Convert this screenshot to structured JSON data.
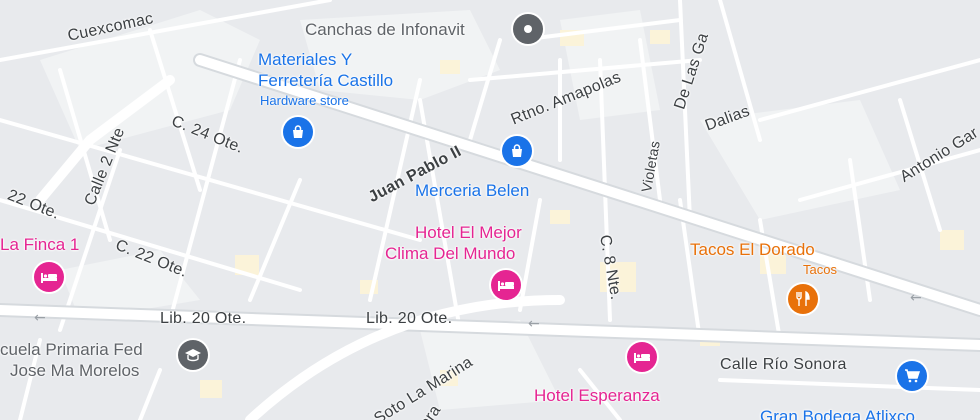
{
  "colors": {
    "shopping": "#1a73e8",
    "lodging": "#e52592",
    "food": "#e8710a",
    "landmark": "#5f6368",
    "street_text": "#3c4043"
  },
  "streets": {
    "cuexcomac": "Cuexcomac",
    "c24": "C. 24 Ote.",
    "calle2": "Calle 2 Nte",
    "c22a": "22 Ote.",
    "c22b": "C. 22 Ote.",
    "juan_pablo": "Juan Pablo II",
    "amapolas": "Rtno. Amapolas",
    "de_las": "De Las Ga",
    "dalias": "Dalias",
    "violetas": "Violetas",
    "antonio": "Antonio Gar",
    "c8": "C. 8 Nte.",
    "lib20a": "Lib. 20 Ote.",
    "lib20b": "Lib. 20 Ote.",
    "rio_sonora": "Calle Río Sonora",
    "soto": "Soto La Marina",
    "ora": "ora"
  },
  "pois": {
    "canchas": {
      "name": "Canchas de Infonavit",
      "icon": "landmark-pin-icon"
    },
    "materiales": {
      "name1": "Materiales Y",
      "name2": "Ferretería Castillo",
      "category": "Hardware store",
      "icon": "shopping-bag-icon"
    },
    "merceria": {
      "name": "Merceria Belen",
      "icon": "shopping-bag-icon"
    },
    "hotel_mejor": {
      "name1": "Hotel El Mejor",
      "name2": "Clima Del Mundo",
      "icon": "bed-icon"
    },
    "la_finca": {
      "name": "La Finca 1",
      "icon": "bed-icon"
    },
    "tacos": {
      "name": "Tacos El Dorado",
      "category": "Tacos",
      "icon": "fork-knife-icon"
    },
    "escuela": {
      "name1": "cuela Primaria Fed",
      "name2": "Jose Ma Morelos",
      "icon": "school-icon"
    },
    "hotel_esperanza": {
      "name": "Hotel Esperanza",
      "icon": "bed-icon"
    },
    "bodega": {
      "name": "Gran Bodega Atlixco",
      "icon": "shopping-cart-icon"
    }
  }
}
